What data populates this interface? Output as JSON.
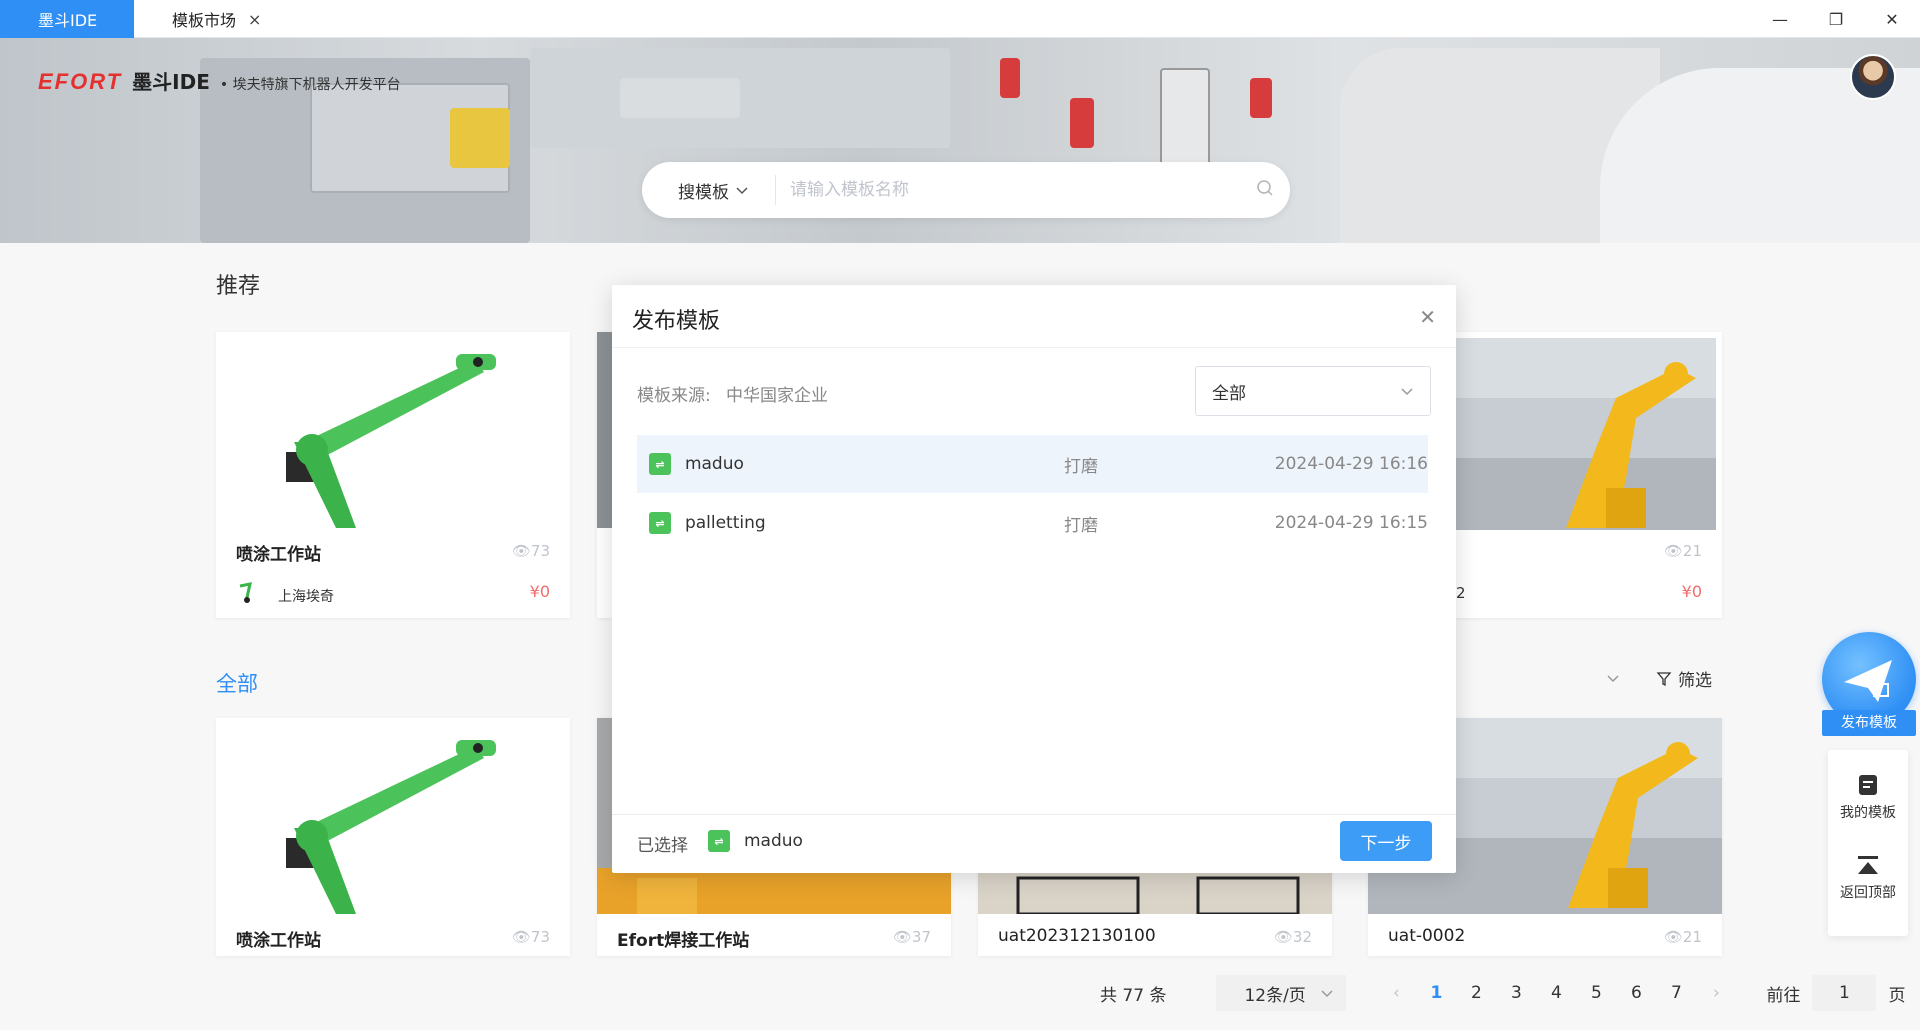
{
  "titlebar": {
    "tabs": [
      {
        "label": "墨斗IDE",
        "active": true
      },
      {
        "label": "模板市场",
        "active": false
      }
    ],
    "close_glyph": "×",
    "controls": [
      "—",
      "❐",
      "✕"
    ]
  },
  "banner": {
    "logo": "EFORT",
    "name": "墨斗IDE",
    "subtitle": "• 埃夫特旗下机器人开发平台"
  },
  "search": {
    "type": "搜模板",
    "placeholder": "请输入模板名称"
  },
  "recommend": {
    "title": "推荐",
    "card1": {
      "title": "喷涂工作站",
      "views": "73",
      "author": "上海埃奇",
      "price": "¥0"
    },
    "card4": {
      "title": "2",
      "views": "21",
      "price": "¥0"
    }
  },
  "all": {
    "title": "全部",
    "filter": "筛选",
    "cards": [
      {
        "title": "喷涂工作站",
        "views": "73"
      },
      {
        "title": "Efort焊接工作站",
        "views": "37"
      },
      {
        "title": "uat202312130100",
        "views": "32"
      },
      {
        "title": "uat-0002",
        "views": "21"
      }
    ]
  },
  "pagination": {
    "total": "共 77 条",
    "page_size": "12条/页",
    "pages": [
      "1",
      "2",
      "3",
      "4",
      "5",
      "6",
      "7"
    ],
    "current": "1",
    "goto_label": "前往",
    "goto_value": "1",
    "page_unit": "页"
  },
  "modal": {
    "title": "发布模板",
    "source_label": "模板来源:",
    "source_value": "中华国家企业",
    "select_value": "全部",
    "rows": [
      {
        "name": "maduo",
        "type": "打磨",
        "date": "2024-04-29 16:16",
        "selected": true
      },
      {
        "name": "palletting",
        "type": "打磨",
        "date": "2024-04-29 16:15",
        "selected": false
      }
    ],
    "selected_label": "已选择",
    "selected_name": "maduo",
    "next_label": "下一步"
  },
  "side": {
    "publish_label": "发布模板",
    "my_templates": "我的模板",
    "back_to_top": "返回顶部"
  },
  "colors": {
    "accent": "#2f8ff5",
    "brand_red": "#e53030",
    "price": "#f56c6c",
    "template_icon": "#4cc25a"
  }
}
